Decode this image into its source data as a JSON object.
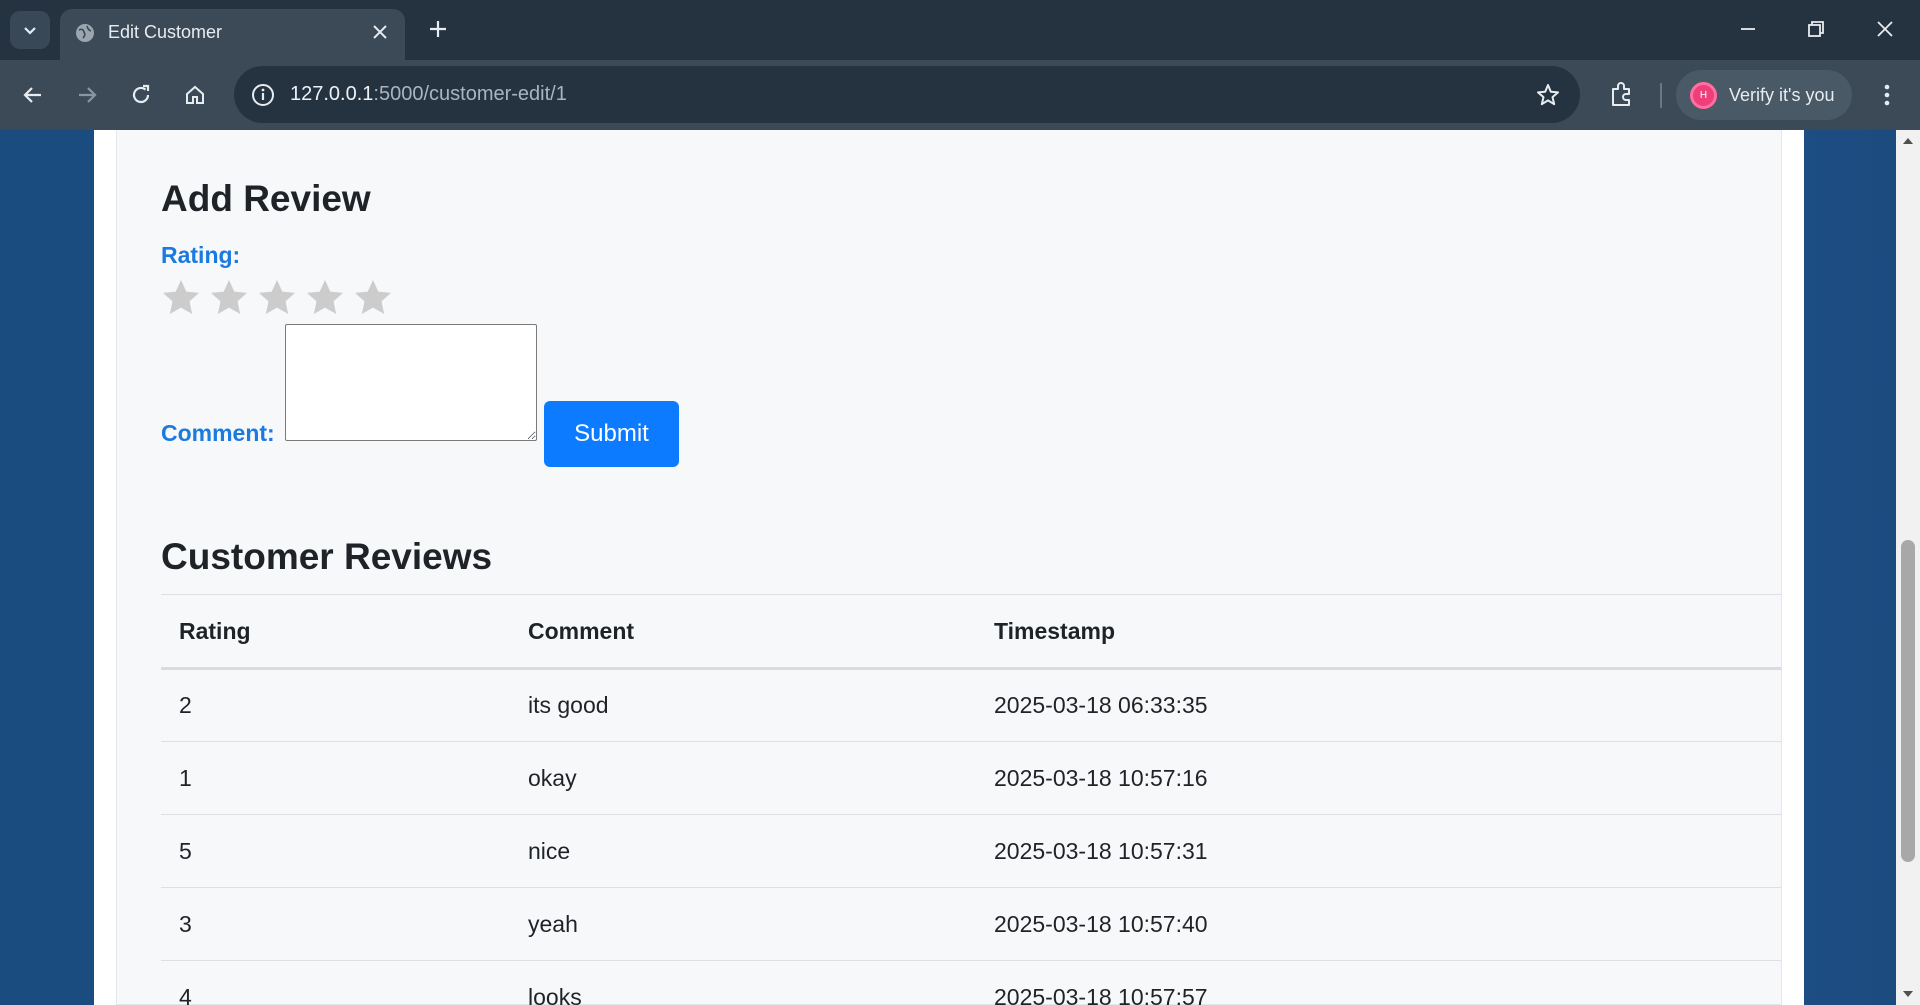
{
  "browser": {
    "tab_title": "Edit Customer",
    "url_host": "127.0.0.1",
    "url_path": ":5000/customer-edit/1",
    "profile_label": "Verify it's you",
    "profile_initial": "H"
  },
  "form": {
    "heading": "Add Review",
    "rating_label": "Rating:",
    "rating_value": 0,
    "rating_max": 5,
    "comment_label": "Comment:",
    "comment_value": "",
    "submit_label": "Submit"
  },
  "reviews": {
    "heading": "Customer Reviews",
    "columns": [
      "Rating",
      "Comment",
      "Timestamp"
    ],
    "rows": [
      {
        "rating": "2",
        "comment": "its good",
        "timestamp": "2025-03-18 06:33:35"
      },
      {
        "rating": "1",
        "comment": "okay",
        "timestamp": "2025-03-18 10:57:16"
      },
      {
        "rating": "5",
        "comment": "nice",
        "timestamp": "2025-03-18 10:57:31"
      },
      {
        "rating": "3",
        "comment": "yeah",
        "timestamp": "2025-03-18 10:57:40"
      },
      {
        "rating": "4",
        "comment": "looks",
        "timestamp": "2025-03-18 10:57:57"
      }
    ]
  },
  "colors": {
    "accent": "#0d7bff",
    "label_blue": "#1a7ae0",
    "star_empty": "#cccccc"
  }
}
